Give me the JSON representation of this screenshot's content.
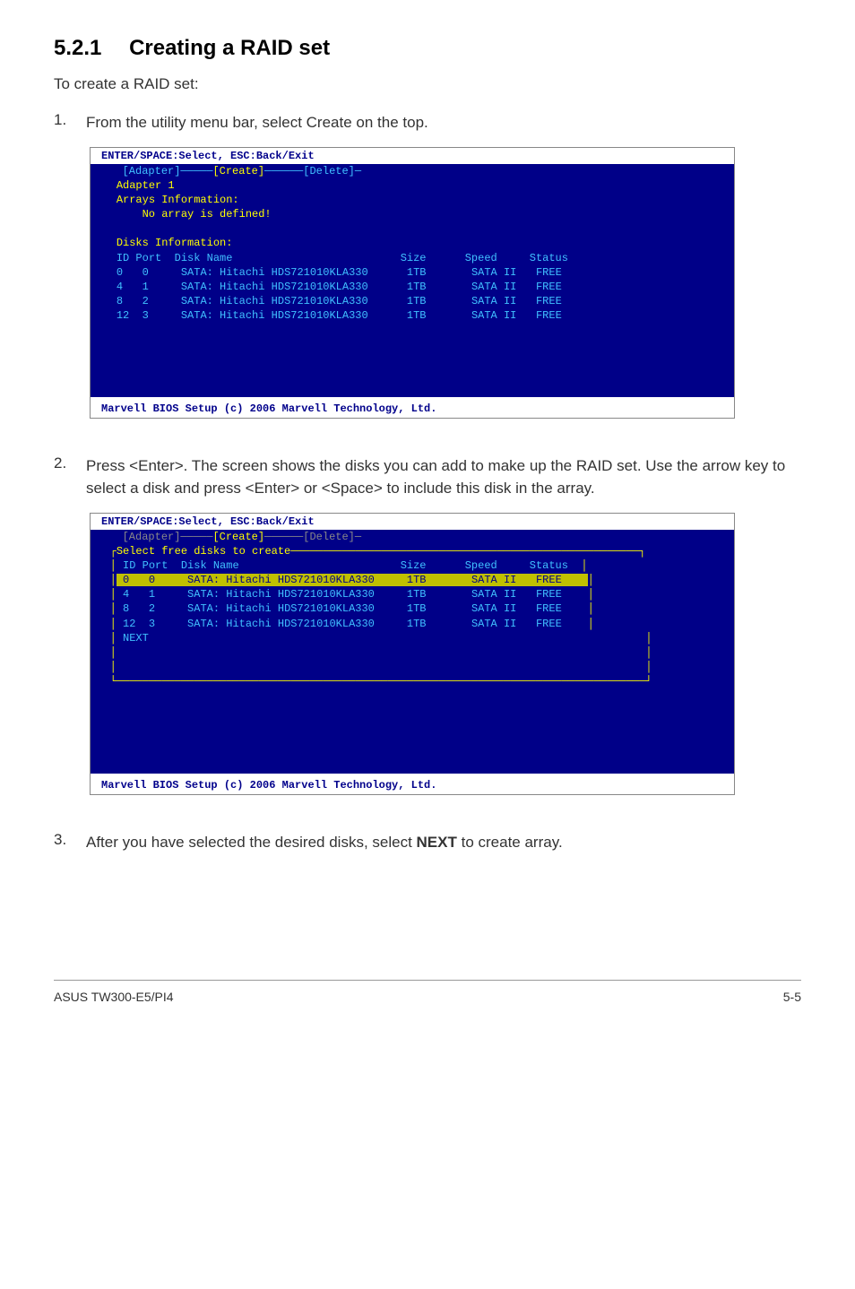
{
  "section": {
    "number": "5.2.1",
    "title": "Creating a RAID set"
  },
  "intro": "To create a RAID set:",
  "steps": [
    {
      "num": "1.",
      "text": "From the utility menu bar, select Create on the top."
    },
    {
      "num": "2.",
      "text": "Press <Enter>. The screen shows the disks you can add to make up the RAID set. Use the arrow key to select a disk and press <Enter> or <Space> to include this disk in the array."
    },
    {
      "num": "3.",
      "text": "After you have selected the desired disks, select NEXT to create array."
    }
  ],
  "bios": {
    "header": "ENTER/SPACE:Select, ESC:Back/Exit",
    "footer": "Marvell BIOS Setup (c) 2006 Marvell Technology, Ltd.",
    "menu": {
      "adapter": "[Adapter]",
      "create": "[Create]",
      "delete": "[Delete]"
    },
    "adapter_label": "Adapter 1",
    "arrays_label": "Arrays Information:",
    "noarray": "No array is defined!",
    "disks_label": "Disks Information:",
    "table_headers": {
      "idport": "ID Port",
      "diskname": "Disk Name",
      "size": "Size",
      "speed": "Speed",
      "status": "Status"
    },
    "rows": [
      {
        "id": "0",
        "port": "0",
        "name": "SATA: Hitachi HDS721010KLA330",
        "size": "1TB",
        "speed": "SATA II",
        "status": "FREE"
      },
      {
        "id": "4",
        "port": "1",
        "name": "SATA: Hitachi HDS721010KLA330",
        "size": "1TB",
        "speed": "SATA II",
        "status": "FREE"
      },
      {
        "id": "8",
        "port": "2",
        "name": "SATA: Hitachi HDS721010KLA330",
        "size": "1TB",
        "speed": "SATA II",
        "status": "FREE"
      },
      {
        "id": "12",
        "port": "3",
        "name": "SATA: Hitachi HDS721010KLA330",
        "size": "1TB",
        "speed": "SATA II",
        "status": "FREE"
      }
    ],
    "select_label": "Select free disks to create",
    "next": "NEXT"
  },
  "footer": {
    "left": "ASUS TW300-E5/PI4",
    "right": "5-5"
  }
}
